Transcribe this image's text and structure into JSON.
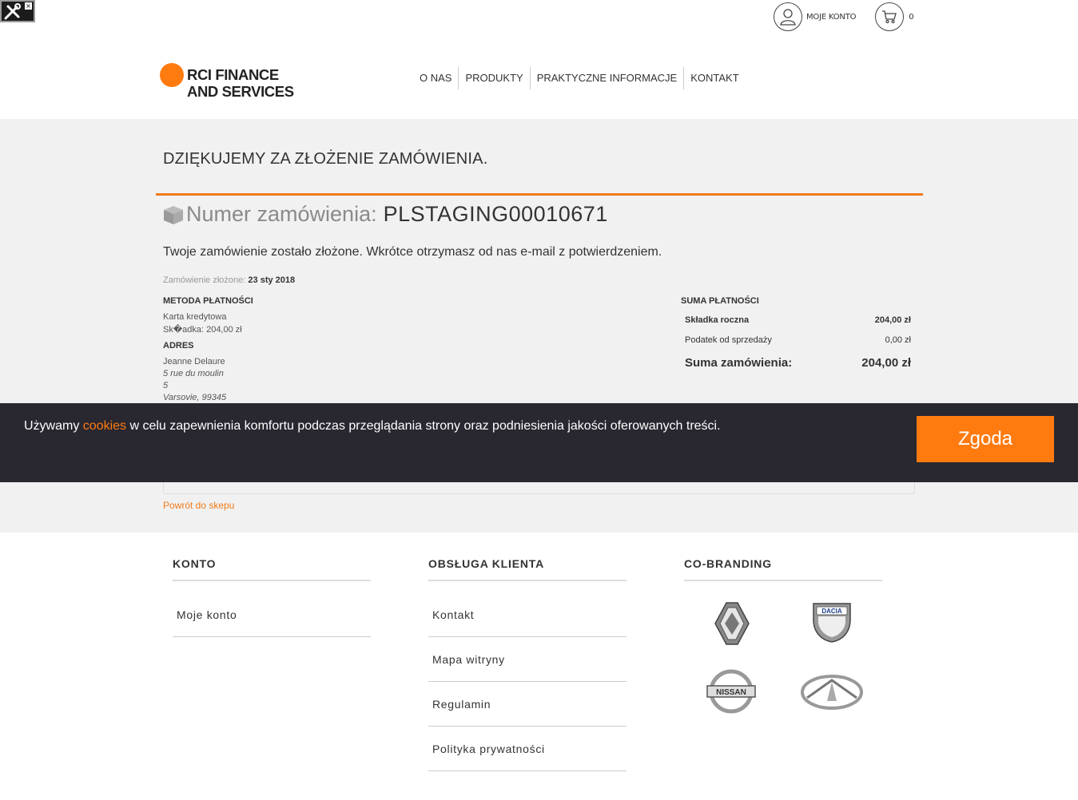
{
  "header": {
    "account_label": "MOJE KONTO",
    "cart_count": "0",
    "logo_line1": "RCI FINANCE",
    "logo_line2": "AND SERVICES"
  },
  "nav": {
    "items": [
      {
        "label": "O NAS"
      },
      {
        "label": "PRODUKTY"
      },
      {
        "label": "PRAKTYCZNE INFORMACJE"
      },
      {
        "label": "KONTAKT"
      }
    ]
  },
  "order": {
    "thanks_title": "DZIĘKUJEMY ZA ZŁOŻENIE ZAMÓWIENIA.",
    "number_label": "Numer zamówienia:",
    "number_value": "PLSTAGING00010671",
    "message": "Twoje zamówienie zostało złożone. Wkrótce otrzymasz od nas e-mail z potwierdzeniem.",
    "placed_label": "Zamówienie złożone:",
    "placed_date": "23 sty 2018",
    "payment_title": "METODA PŁATNOŚCI",
    "payment_method": "Karta kredytowa",
    "payment_amount": "Sk�adka: 204,00 zł",
    "address_title": "ADRES",
    "address_name": "Jeanne Delaure",
    "address_street": "5 rue du moulin",
    "address_number": "5",
    "address_city": "Varsovie, 99345",
    "summary_title": "SUMA PŁATNOŚCI",
    "summary_rows": [
      {
        "label": "Składka roczna",
        "value": "204,00 zł"
      },
      {
        "label": "Podatek od sprzedaży",
        "value": "0,00 zł"
      },
      {
        "label": "Suma zamówienia:",
        "value": "204,00 zł"
      }
    ],
    "back_link": "Powrót do skepu"
  },
  "cookie": {
    "text_before": "Używamy ",
    "link": "cookies",
    "text_after": " w celu zapewnienia komfortu podczas przeglądania strony oraz podniesienia jakości oferowanych treści.",
    "button": "Zgoda"
  },
  "footer": {
    "account_title": "KONTO",
    "account_links": [
      "Moje konto"
    ],
    "service_title": "OBSŁUGA KLIENTA",
    "service_links": [
      "Kontakt",
      "Mapa witryny",
      "Regulamin",
      "Polityka prywatności"
    ],
    "cobranding_title": "CO-BRANDING",
    "brands": {
      "dacia": "DACIA",
      "nissan": "NISSAN"
    }
  },
  "colors": {
    "accent": "#ff7b10",
    "banner": "#292730",
    "grey_bg": "#f1f1f1"
  }
}
